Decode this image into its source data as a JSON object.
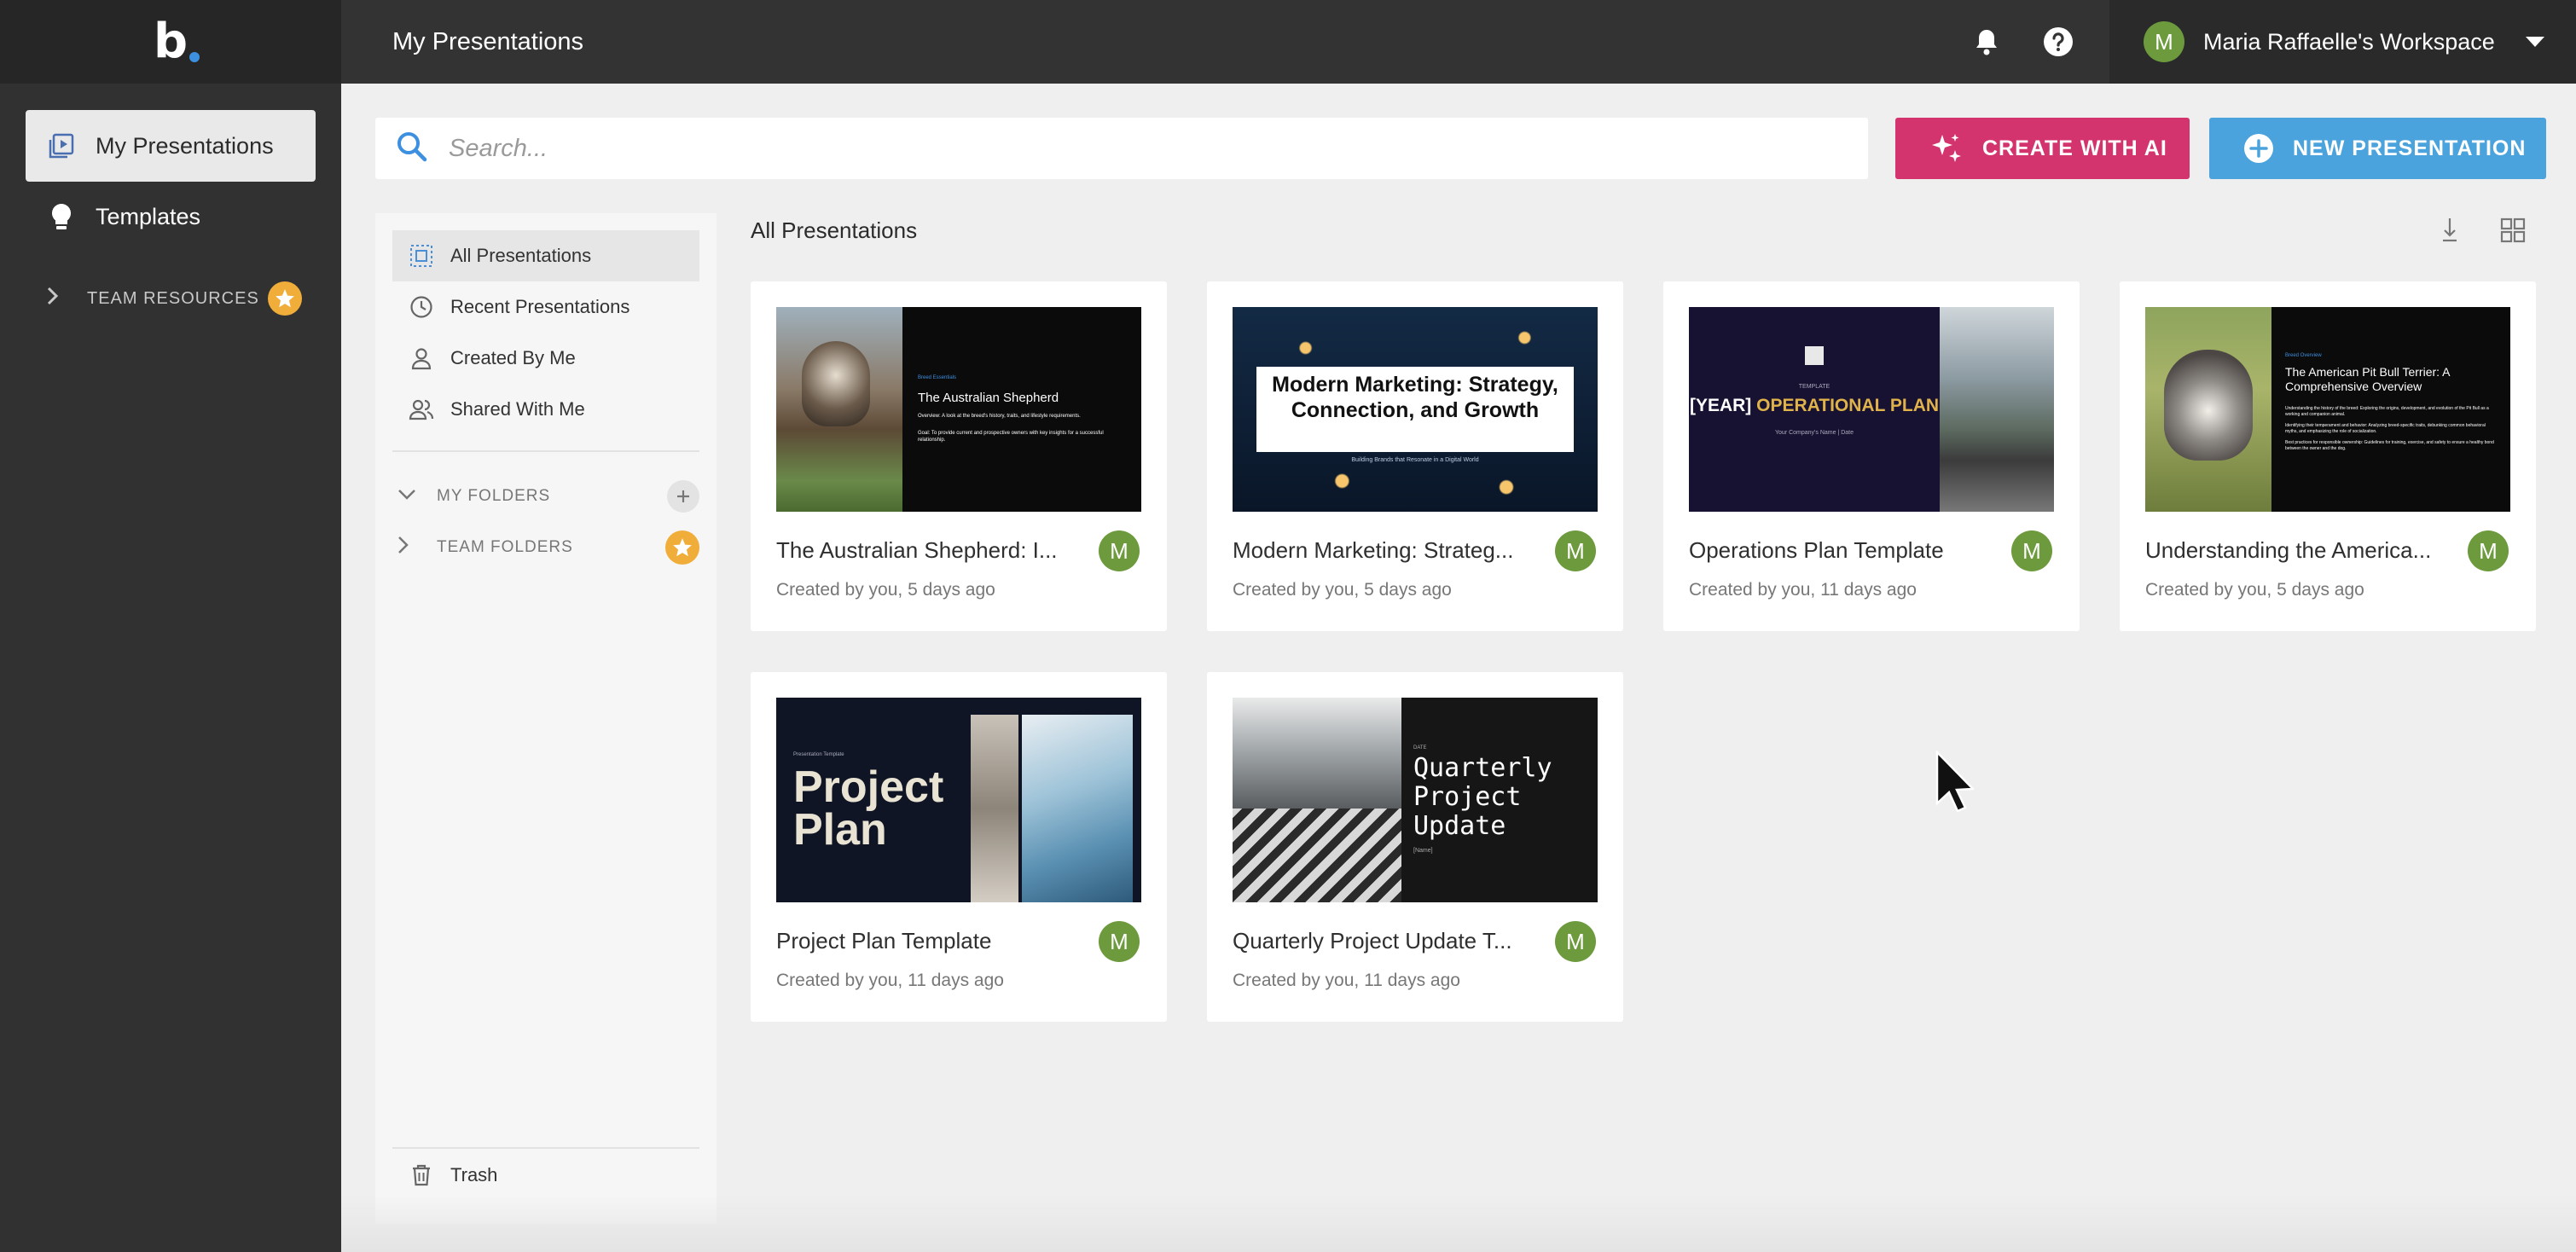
{
  "app": {
    "logo_text": "b"
  },
  "sidebar": {
    "items": [
      {
        "label": "My Presentations",
        "icon": "presentation-icon",
        "active": true
      },
      {
        "label": "Templates",
        "icon": "lightbulb-icon",
        "active": false
      }
    ],
    "team_resources_label": "TEAM RESOURCES"
  },
  "header": {
    "title": "My Presentations",
    "workspace_name": "Maria Raffaelle's Workspace",
    "avatar_initial": "M"
  },
  "search": {
    "placeholder": "Search...",
    "value": ""
  },
  "actions": {
    "create_ai_label": "CREATE WITH AI",
    "new_presentation_label": "NEW PRESENTATION"
  },
  "filters": {
    "items": [
      {
        "label": "All Presentations",
        "active": true
      },
      {
        "label": "Recent Presentations",
        "active": false
      },
      {
        "label": "Created By Me",
        "active": false
      },
      {
        "label": "Shared With Me",
        "active": false
      }
    ],
    "my_folders_label": "MY FOLDERS",
    "team_folders_label": "TEAM FOLDERS",
    "trash_label": "Trash"
  },
  "main": {
    "section_title": "All Presentations",
    "cards": [
      {
        "title": "The Australian Shepherd: I...",
        "subtitle": "Created by you, 5 days ago",
        "avatar": "M",
        "thumb": {
          "kicker": "Breed Essentials",
          "heading": "The Australian Shepherd",
          "bullet1": "Overview: A look at the breed's history, traits, and lifestyle requirements.",
          "bullet2": "Goal: To provide current and prospective owners with key insights for a successful relationship."
        }
      },
      {
        "title": "Modern Marketing: Strateg...",
        "subtitle": "Created by you, 5 days ago",
        "avatar": "M",
        "thumb": {
          "heading": "Modern Marketing: Strategy, Connection, and Growth",
          "sub": "Building Brands that Resonate in a Digital World"
        }
      },
      {
        "title": "Operations Plan Template",
        "subtitle": "Created by you, 11 days ago",
        "avatar": "M",
        "thumb": {
          "kicker": "TEMPLATE",
          "year": "[YEAR]",
          "heading": "OPERATIONAL PLAN",
          "sub": "Your Company's Name  |  Date"
        }
      },
      {
        "title": "Understanding the America...",
        "subtitle": "Created by you, 5 days ago",
        "avatar": "M",
        "thumb": {
          "kicker": "Breed Overview",
          "heading": "The American Pit Bull Terrier: A Comprehensive Overview",
          "bullet1": "Understanding the history of the breed: Exploring the origins, development, and evolution of the Pit Bull as a working and companion animal.",
          "bullet2": "Identifying their temperament and behavior: Analyzing breed-specific traits, debunking common behavioral myths, and emphasizing the role of socialization.",
          "bullet3": "Best practices for responsible ownership: Guidelines for training, exercise, and safety to ensure a healthy bond between the owner and the dog."
        }
      },
      {
        "title": "Project Plan Template",
        "subtitle": "Created by you, 11 days ago",
        "avatar": "M",
        "thumb": {
          "kicker": "Presentation Template",
          "heading_line1": "Project",
          "heading_line2": "Plan"
        }
      },
      {
        "title": "Quarterly Project Update T...",
        "subtitle": "Created by you, 11 days ago",
        "avatar": "M",
        "thumb": {
          "kicker": "DATE",
          "heading_line1": "Quarterly",
          "heading_line2": "Project",
          "heading_line3": "Update",
          "sub": "[Name]"
        }
      }
    ]
  },
  "colors": {
    "sidebar_bg": "#313131",
    "header_bg": "#333333",
    "accent_ai": "#d3346d",
    "accent_new": "#4aa3dc",
    "avatar_bg": "#6c9a3d",
    "star_badge": "#f0ad3a"
  }
}
